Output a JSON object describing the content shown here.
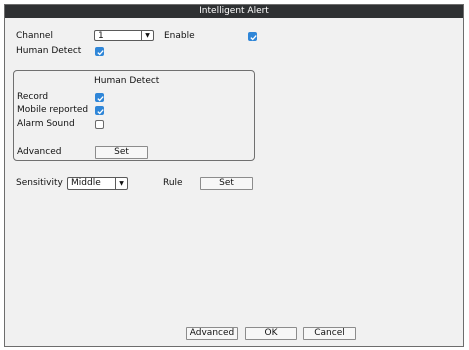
{
  "window": {
    "title": "Intelligent Alert"
  },
  "channel": {
    "label": "Channel",
    "value": "1"
  },
  "enable": {
    "label": "Enable",
    "checked": true
  },
  "human_detect": {
    "label": "Human Detect",
    "checked": true
  },
  "group": {
    "title": "Human Detect",
    "record": {
      "label": "Record",
      "checked": true
    },
    "mobile_reported": {
      "label": "Mobile reported",
      "checked": true
    },
    "alarm_sound": {
      "label": "Alarm Sound",
      "checked": false
    },
    "advanced": {
      "label": "Advanced",
      "button": "Set"
    }
  },
  "sensitivity": {
    "label": "Sensitivity",
    "value": "Middle"
  },
  "rule": {
    "label": "Rule",
    "button": "Set"
  },
  "footer": {
    "advanced": "Advanced",
    "ok": "OK",
    "cancel": "Cancel"
  },
  "colors": {
    "title_bar": "#2f3133",
    "checkbox_on": "#2f86d8",
    "panel": "#f1f1f1"
  }
}
